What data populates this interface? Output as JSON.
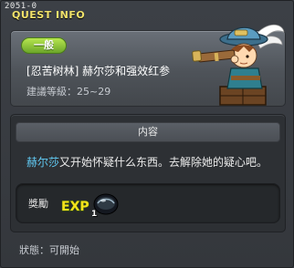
{
  "window": {
    "quest_code": "2051-0",
    "title": "QUEST INFO"
  },
  "quest": {
    "category": "一般",
    "title": "[忍苦树林] 赫尔莎和强效红参",
    "level_requirement": "建議等級：25~29"
  },
  "content": {
    "header": "内容",
    "description_npc": "赫尔莎",
    "description_text": "又开始怀疑什么东西。去解除她的疑心吧。"
  },
  "reward": {
    "label": "獎勵",
    "exp_text": "EXP",
    "item_quantity": "1"
  },
  "status": {
    "text": "狀態：可開始"
  },
  "colors": {
    "title_yellow": "#f1e26a",
    "badge_green": "#8cc63f",
    "npc_name_blue": "#61c9f2",
    "exp_yellow": "#f5e21b"
  },
  "icons": {
    "npc": "npc-explorer-portrait-icon",
    "exp": "exp-icon",
    "reward_item": "dark-orb-item-icon"
  }
}
